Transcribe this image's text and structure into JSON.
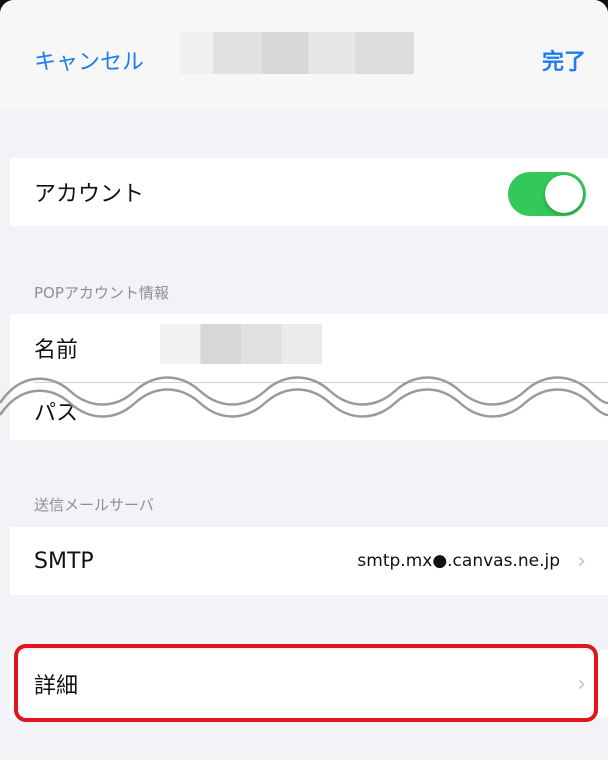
{
  "navbar": {
    "cancel_label": "キャンセル",
    "done_label": "完了"
  },
  "account": {
    "label": "アカウント",
    "toggle_on": true
  },
  "pop_section": {
    "header": "POPアカウント情報",
    "name_label": "名前",
    "password_label": "パス"
  },
  "outgoing_section": {
    "header": "送信メールサーバ",
    "smtp_label": "SMTP",
    "smtp_value": "smtp.mx●.canvas.ne.jp",
    "chevron": "›"
  },
  "advanced": {
    "label": "詳細",
    "chevron": "›"
  },
  "colors": {
    "accent": "#1e7cf2",
    "toggle_on": "#34c759",
    "highlight": "#e0161c",
    "background": "#f2f2f7"
  }
}
